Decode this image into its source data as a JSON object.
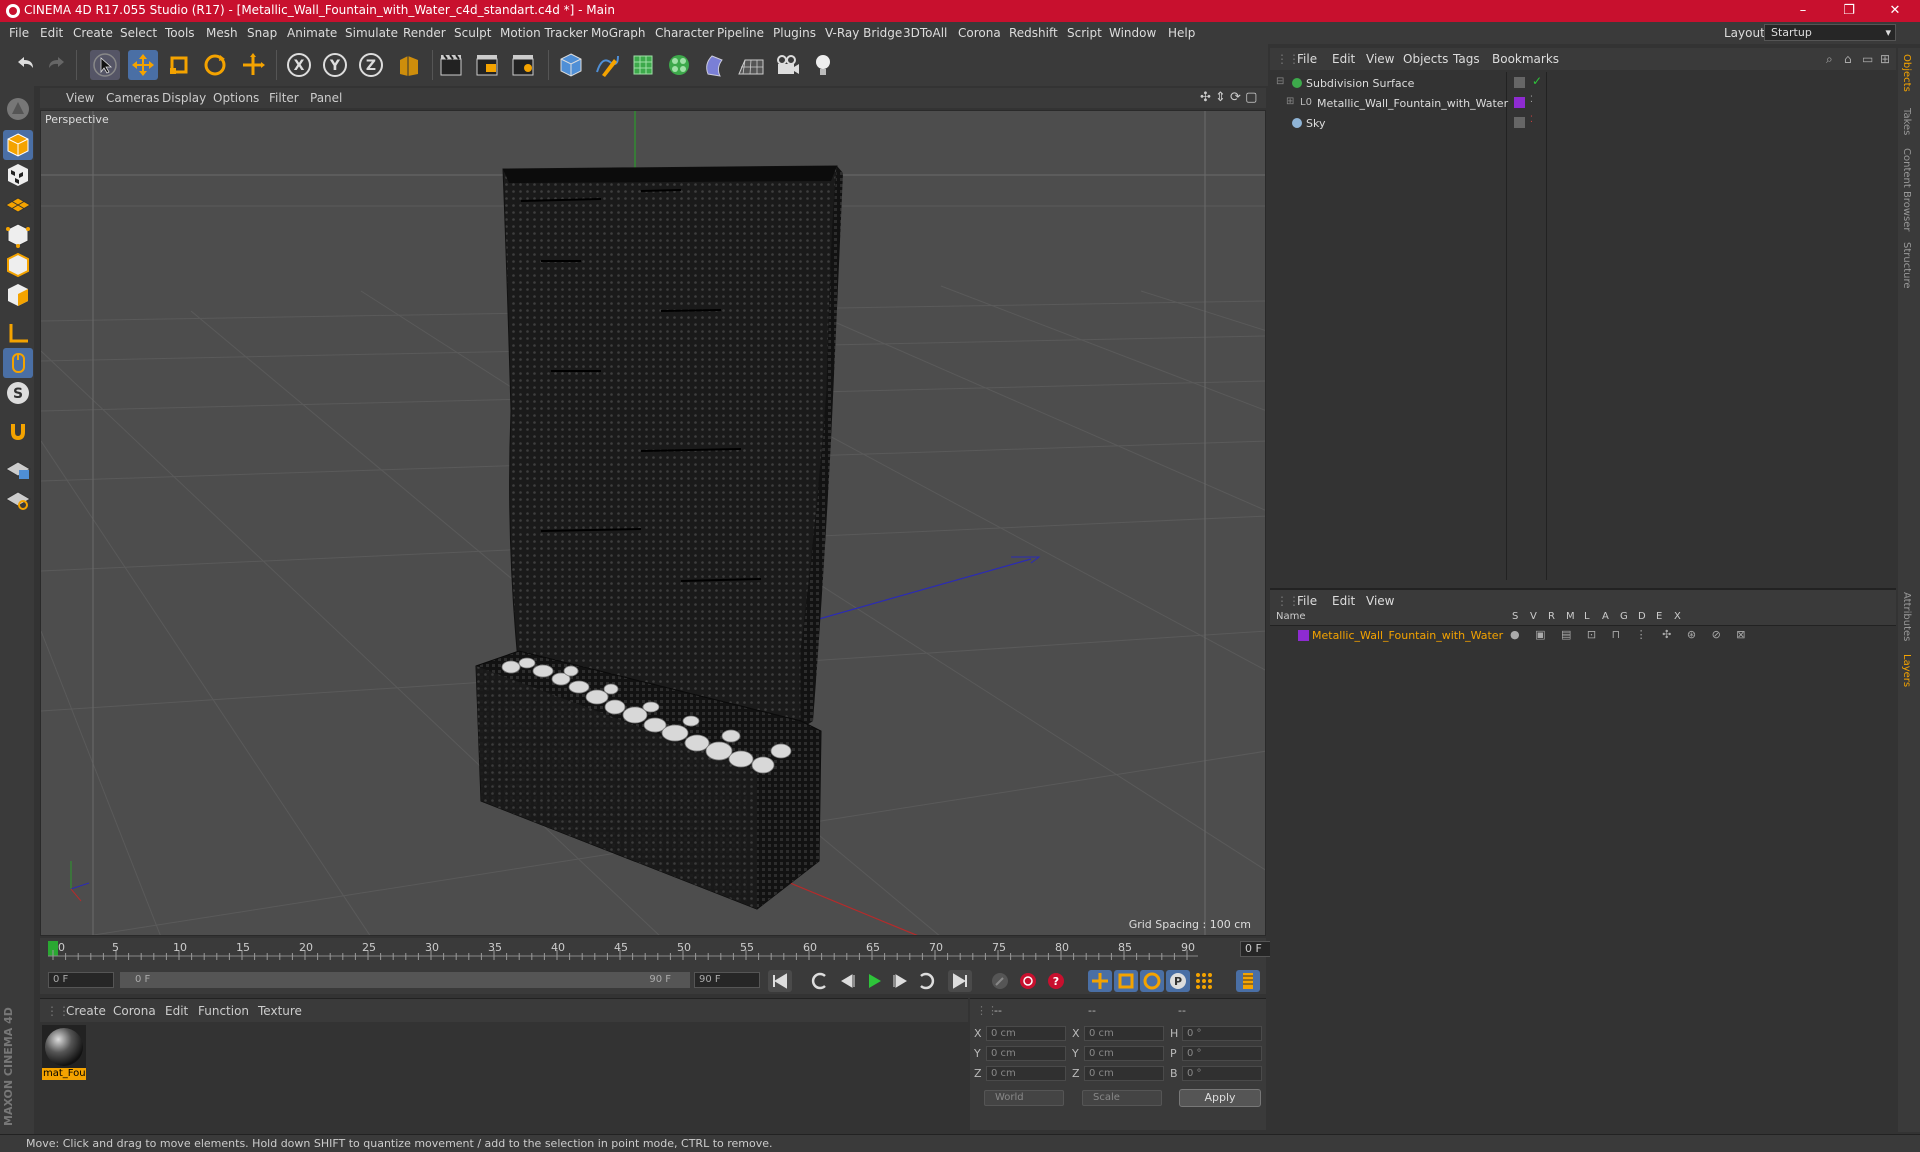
{
  "window": {
    "title": "CINEMA 4D R17.055 Studio (R17) - [Metallic_Wall_Fountain_with_Water_c4d_standart.c4d *] - Main",
    "controls": [
      "–",
      "❐",
      "✕"
    ]
  },
  "menu": {
    "items": [
      "File",
      "Edit",
      "Create",
      "Select",
      "Tools",
      "Mesh",
      "Snap",
      "Animate",
      "Simulate",
      "Render",
      "Sculpt",
      "Motion Tracker",
      "MoGraph",
      "Character",
      "Pipeline",
      "Plugins",
      "V-Ray Bridge",
      "3DToAll",
      "Corona",
      "Redshift",
      "Script",
      "Window",
      "Help"
    ],
    "layout_label": "Layout:",
    "layout_value": "Startup"
  },
  "toolbar": {
    "icons": [
      "undo-icon",
      "redo-icon",
      "select-icon",
      "move-icon",
      "scale-icon",
      "rotate-icon",
      "transform-icon",
      "x-axis-icon",
      "y-axis-icon",
      "z-axis-icon",
      "coordinate-system-icon",
      "render-view-icon",
      "render-picture-viewer-icon",
      "render-settings-icon",
      "cube-icon",
      "pen-icon",
      "subdivision-icon",
      "cloner-icon",
      "deformer-icon",
      "floor-icon",
      "camera-icon",
      "light-icon"
    ],
    "axis_labels": [
      "X",
      "Y",
      "Z"
    ]
  },
  "viewport": {
    "menu": [
      "View",
      "Cameras",
      "Display",
      "Options",
      "Filter",
      "Panel"
    ],
    "label": "Perspective",
    "grid_spacing": "Grid Spacing : 100 cm"
  },
  "timeline": {
    "ticks": [
      "0",
      "5",
      "10",
      "15",
      "20",
      "25",
      "30",
      "35",
      "40",
      "45",
      "50",
      "55",
      "60",
      "65",
      "70",
      "75",
      "80",
      "85",
      "90"
    ],
    "current_frame": "0 F",
    "start_field": "0 F",
    "range_start": "0 F",
    "range_end": "90 F",
    "end_field": "90 F"
  },
  "materials": {
    "menu": [
      "Create",
      "Corona",
      "Edit",
      "Function",
      "Texture"
    ],
    "items": [
      {
        "name": "mat_Fou"
      }
    ]
  },
  "coordinates": {
    "headers": [
      "--",
      "--",
      "--"
    ],
    "rows": [
      {
        "a": "X",
        "av": "0 cm",
        "b": "X",
        "bv": "0 cm",
        "c": "H",
        "cv": "0 °"
      },
      {
        "a": "Y",
        "av": "0 cm",
        "b": "Y",
        "bv": "0 cm",
        "c": "P",
        "cv": "0 °"
      },
      {
        "a": "Z",
        "av": "0 cm",
        "b": "Z",
        "bv": "0 cm",
        "c": "B",
        "cv": "0 °"
      }
    ],
    "mode1": "World",
    "mode2": "Scale",
    "apply": "Apply"
  },
  "status": {
    "text": "Move: Click and drag to move elements. Hold down SHIFT to quantize movement / add to the selection in point mode, CTRL to remove."
  },
  "object_manager": {
    "menu": [
      "File",
      "Edit",
      "View",
      "Objects",
      "Tags",
      "Bookmarks"
    ],
    "objects": [
      {
        "name": "Subdivision Surface"
      },
      {
        "name": "Metallic_Wall_Fountain_with_Water"
      },
      {
        "name": "Sky"
      }
    ]
  },
  "layer_manager": {
    "menu": [
      "File",
      "Edit",
      "View"
    ],
    "columns": [
      "Name",
      "S",
      "V",
      "R",
      "M",
      "L",
      "A",
      "G",
      "D",
      "E",
      "X"
    ],
    "layers": [
      {
        "name": "Metallic_Wall_Fountain_with_Water",
        "color": "#8e2bd1"
      }
    ]
  },
  "side_tabs": [
    "Objects",
    "Takes",
    "Content Browser",
    "Structure",
    "Attributes",
    "Layers"
  ],
  "colors": {
    "accent": "#f4a300",
    "titlebar": "#c8102e",
    "layer": "#8e2bd1"
  }
}
